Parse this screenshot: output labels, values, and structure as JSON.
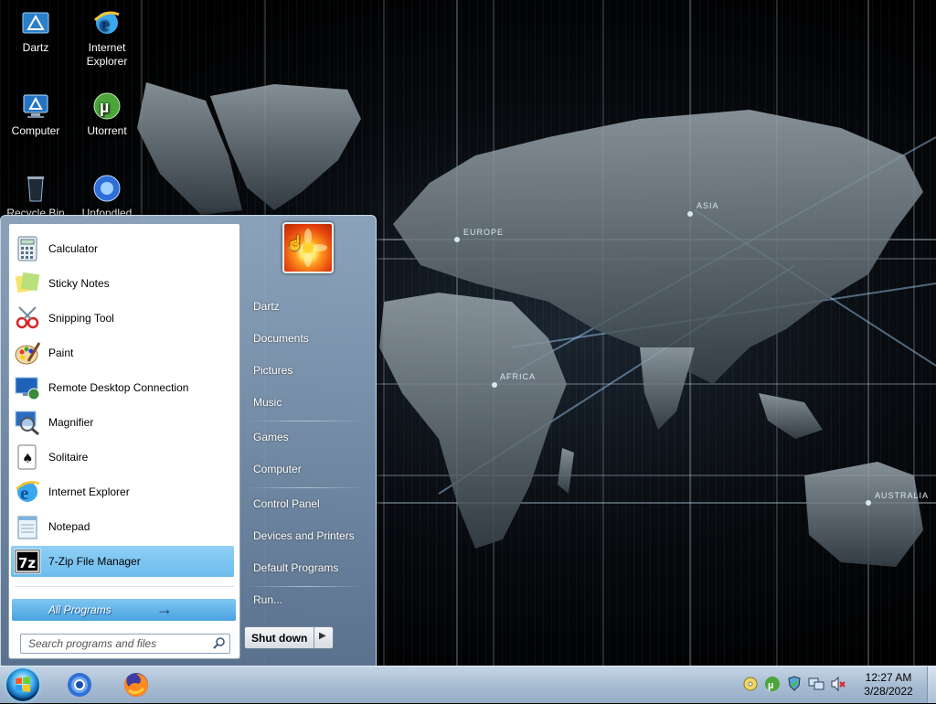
{
  "desktop": {
    "icons": [
      {
        "label": "Dartz",
        "icon": "dartz-logo-icon"
      },
      {
        "label": "Internet Explorer",
        "label_lines": [
          "Internet",
          "Explorer"
        ],
        "icon": "internet-explorer-icon"
      },
      {
        "label": "Computer",
        "icon": "computer-icon"
      },
      {
        "label": "Utorrent",
        "icon": "utorrent-icon"
      },
      {
        "label": "Recycle Bin",
        "icon": "recycle-bin-icon"
      },
      {
        "label": "Unfondled",
        "icon": "unfondled-icon"
      }
    ],
    "wallpaper_labels": [
      "EUROPE",
      "ASIA",
      "AFRICA",
      "AUSTRALIA"
    ]
  },
  "start_menu": {
    "programs": [
      {
        "label": "Calculator",
        "icon": "calculator-icon"
      },
      {
        "label": "Sticky Notes",
        "icon": "sticky-notes-icon"
      },
      {
        "label": "Snipping Tool",
        "icon": "snipping-tool-icon"
      },
      {
        "label": "Paint",
        "icon": "paint-icon"
      },
      {
        "label": "Remote Desktop Connection",
        "icon": "remote-desktop-icon"
      },
      {
        "label": "Magnifier",
        "icon": "magnifier-icon"
      },
      {
        "label": "Solitaire",
        "icon": "solitaire-icon"
      },
      {
        "label": "Internet Explorer",
        "icon": "internet-explorer-icon"
      },
      {
        "label": "Notepad",
        "icon": "notepad-icon"
      },
      {
        "label": "7-Zip File Manager",
        "icon": "7zip-icon",
        "highlighted": true,
        "icon_text": "7z"
      }
    ],
    "all_programs_label": "All Programs",
    "search_placeholder": "Search programs and files",
    "right_items": [
      "Dartz",
      "Documents",
      "Pictures",
      "Music",
      "Games",
      "Computer",
      "Control Panel",
      "Devices and Printers",
      "Default Programs",
      "Run..."
    ],
    "shutdown_label": "Shut down"
  },
  "taskbar": {
    "pinned": [
      {
        "name": "start-orb",
        "icon": "windows-logo-icon"
      },
      {
        "name": "chromium",
        "icon": "chromium-icon"
      },
      {
        "name": "firefox",
        "icon": "firefox-icon"
      }
    ],
    "tray_icons": [
      "cd-drive-icon",
      "utorrent-tray-icon",
      "security-shield-icon",
      "network-icon",
      "volume-muted-icon"
    ],
    "clock_time": "12:27 AM",
    "clock_date": "3/28/2022"
  },
  "colors": {
    "highlight": "#6dbbec",
    "accent_blue": "#3aa9ea"
  }
}
